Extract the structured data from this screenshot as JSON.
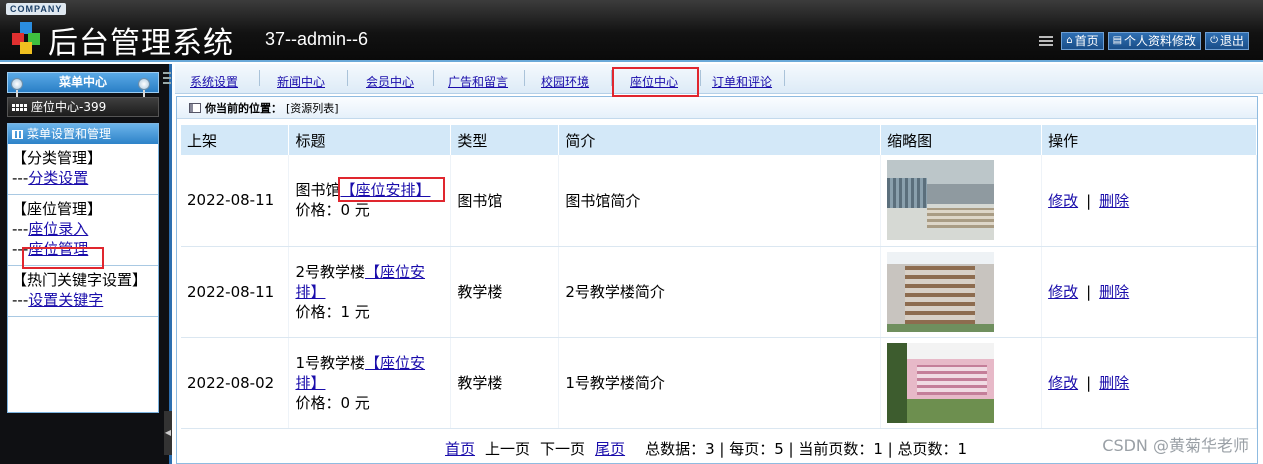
{
  "header": {
    "company": "COMPANY",
    "title": "后台管理系统",
    "user_info": "37--admin--6",
    "buttons": [
      {
        "icon": "home-icon",
        "label": "首页"
      },
      {
        "icon": "profile-icon",
        "label": "个人资料修改"
      },
      {
        "icon": "power-icon",
        "label": "退出"
      }
    ]
  },
  "sidebar": {
    "menu_center": "菜单中心",
    "current_module": "座位中心-399",
    "panel_title": "菜单设置和管理",
    "groups": [
      {
        "title": "【分类管理】",
        "items": [
          {
            "prefix": "---",
            "label": "分类设置"
          }
        ]
      },
      {
        "title": "【座位管理】",
        "items": [
          {
            "prefix": "---",
            "label": "座位录入"
          },
          {
            "prefix": "---",
            "label": "座位管理"
          }
        ]
      },
      {
        "title": "【热门关键字设置】",
        "items": [
          {
            "prefix": "---",
            "label": "设置关键字"
          }
        ]
      }
    ]
  },
  "topnav": {
    "tabs": [
      "系统设置",
      "新闻中心",
      "会员中心",
      "广告和留言",
      "校园环境",
      "座位中心",
      "订单和评论"
    ],
    "active": "座位中心"
  },
  "breadcrumb": {
    "label": "你当前的位置：",
    "value": "[资源列表]"
  },
  "table": {
    "headers": [
      "上架",
      "标题",
      "类型",
      "简介",
      "缩略图",
      "操作"
    ],
    "rows": [
      {
        "date": "2022-08-11",
        "name": "图书馆",
        "link": "【座位安排】",
        "price": "价格：0 元",
        "type": "图书馆",
        "desc": "图书馆简介",
        "thumb": "library-photo",
        "edit": "修改",
        "delete": "删除"
      },
      {
        "date": "2022-08-11",
        "name": "2号教学楼",
        "link": "【座位安排】",
        "price": "价格：1 元",
        "type": "教学楼",
        "desc": "2号教学楼简介",
        "thumb": "building-2-photo",
        "edit": "修改",
        "delete": "删除"
      },
      {
        "date": "2022-08-02",
        "name": "1号教学楼",
        "link": "【座位安排】",
        "price": "价格：0 元",
        "type": "教学楼",
        "desc": "1号教学楼简介",
        "thumb": "building-1-photo",
        "edit": "修改",
        "delete": "删除"
      }
    ],
    "separator": "|"
  },
  "pager": {
    "first": "首页",
    "prev": "上一页",
    "next": "下一页",
    "last": "尾页",
    "stats": "总数据：3 | 每页：5 | 当前页数：1 | 总页数：1"
  },
  "watermark": "CSDN @黄菊华老师",
  "colors": {
    "highlight": "#e0262e",
    "accent": "#2d6fb0",
    "link": "#1a0dab"
  }
}
